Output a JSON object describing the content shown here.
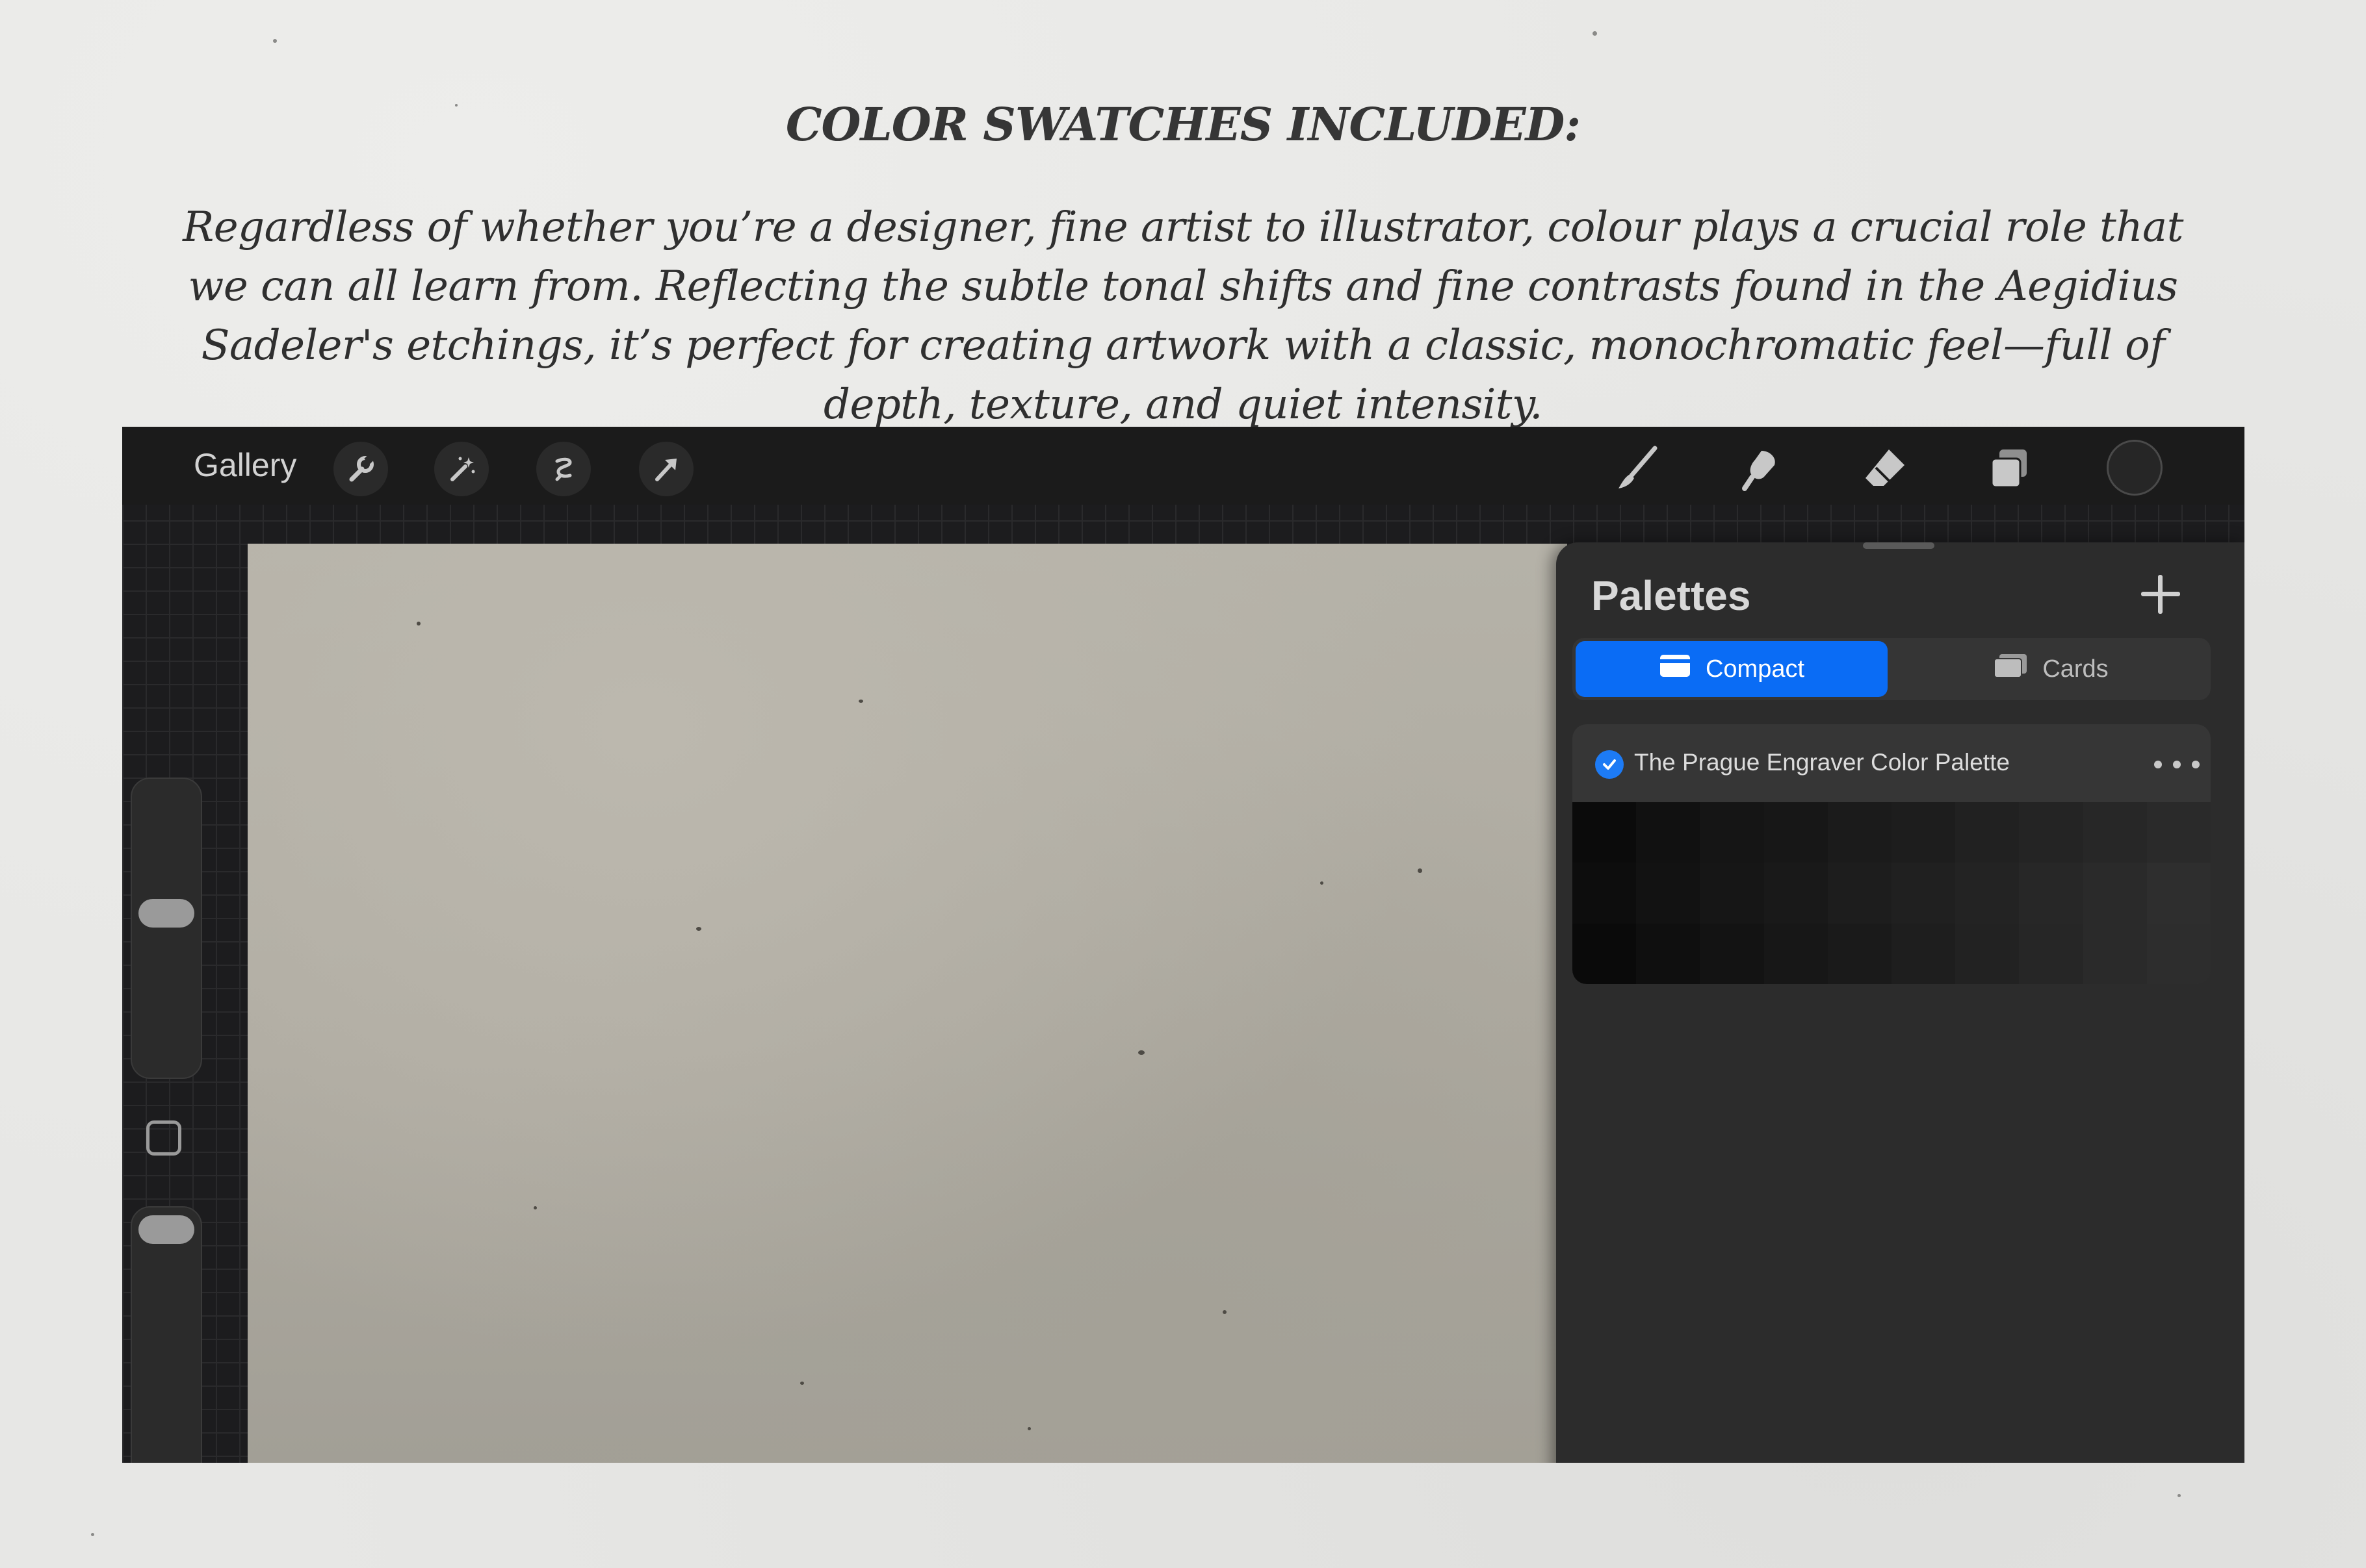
{
  "header": {
    "title": "COLOR SWATCHES INCLUDED:",
    "description": "Regardless of whether you’re a designer, fine artist to illustrator, colour plays a crucial role that we can all learn from. Reflecting the subtle tonal shifts and fine contrasts found in the Aegidius Sadeler's etchings, it’s perfect for creating artwork with a classic, monochromatic feel—full of depth, texture, and quiet intensity."
  },
  "toolbar": {
    "gallery_label": "Gallery",
    "left_tools": [
      "wrench-icon",
      "magic-wand-icon",
      "selection-icon",
      "transform-arrow-icon"
    ],
    "right_tools": [
      "brush-icon",
      "smudge-icon",
      "eraser-icon",
      "layers-icon"
    ],
    "current_color": "#262626"
  },
  "palettes_panel": {
    "title": "Palettes",
    "add_icon": "plus-icon",
    "tabs": [
      {
        "label": "Compact",
        "icon": "compact-icon",
        "active": true
      },
      {
        "label": "Cards",
        "icon": "cards-icon",
        "active": false
      }
    ],
    "palette": {
      "name": "The Prague Engraver Color Palette",
      "default": true,
      "swatches": [
        [
          "#0b0b0b",
          "#111111",
          "#151515",
          "#171717",
          "#1b1b1b",
          "#1d1d1d",
          "#212121",
          "#242424",
          "#272727",
          "#2a2a2a"
        ],
        [
          "#0d0d0d",
          "#121212",
          "#161616",
          "#191919",
          "#1d1d1d",
          "#202020",
          "#232323",
          "#272727",
          "#2a2a2a",
          "#2e2e2e"
        ],
        [
          "#0a0a0a",
          "#0f0f0f",
          "#131313",
          "#171717",
          "#1a1a1a",
          "#1e1e1e",
          "#222222",
          "#262626",
          "#2a2a2a",
          "#2d2d2d"
        ]
      ]
    }
  },
  "colors": {
    "accent": "#0a6cf5",
    "panel_bg": "#2c2c2c",
    "toolbar_bg": "#1b1b1b"
  }
}
